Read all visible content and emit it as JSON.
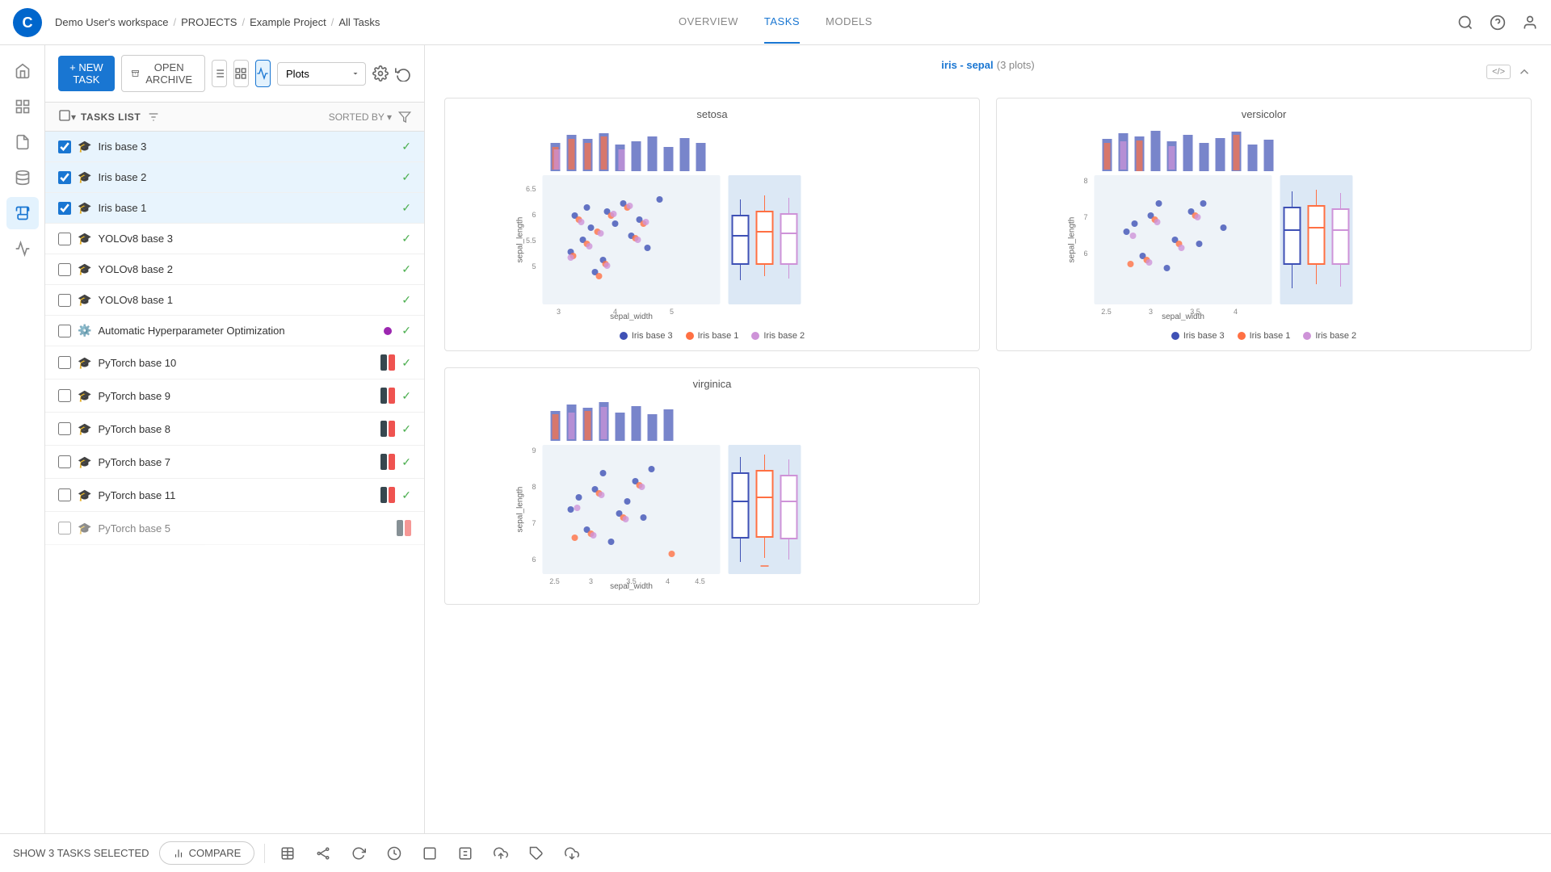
{
  "app": {
    "logo_text": "C",
    "breadcrumb": [
      "Demo User's workspace",
      "PROJECTS",
      "Example Project",
      "All Tasks"
    ]
  },
  "nav": {
    "tabs": [
      "OVERVIEW",
      "TASKS",
      "MODELS"
    ],
    "active_tab": "TASKS"
  },
  "toolbar": {
    "new_task_label": "+ NEW TASK",
    "open_archive_label": "OPEN ARCHIVE",
    "plots_label": "Plots"
  },
  "tasks_list": {
    "header_label": "TASKS LIST",
    "sorted_by_label": "SORTED BY",
    "items": [
      {
        "name": "Iris base 3",
        "checked": true,
        "selected": true,
        "status": "check",
        "type": "model"
      },
      {
        "name": "Iris base 2",
        "checked": true,
        "selected": true,
        "status": "check",
        "type": "model"
      },
      {
        "name": "Iris base 1",
        "checked": true,
        "selected": true,
        "status": "check",
        "type": "model"
      },
      {
        "name": "YOLOv8 base 3",
        "checked": false,
        "selected": false,
        "status": "check",
        "type": "model"
      },
      {
        "name": "YOLOv8 base 2",
        "checked": false,
        "selected": false,
        "status": "check",
        "type": "model"
      },
      {
        "name": "YOLOv8 base 1",
        "checked": false,
        "selected": false,
        "status": "check",
        "type": "model"
      },
      {
        "name": "Automatic Hyperparameter Optimization",
        "checked": false,
        "selected": false,
        "status": "purple_check",
        "type": "hpo"
      },
      {
        "name": "PyTorch base 10",
        "checked": false,
        "selected": false,
        "status": "dual_check",
        "type": "model"
      },
      {
        "name": "PyTorch base 9",
        "checked": false,
        "selected": false,
        "status": "dual_check",
        "type": "model"
      },
      {
        "name": "PyTorch base 8",
        "checked": false,
        "selected": false,
        "status": "dual_check",
        "type": "model"
      },
      {
        "name": "PyTorch base 7",
        "checked": false,
        "selected": false,
        "status": "dual_check",
        "type": "model"
      },
      {
        "name": "PyTorch base 11",
        "checked": false,
        "selected": false,
        "status": "dual_check",
        "type": "model"
      }
    ]
  },
  "plots_section": {
    "title": "iris - sepal",
    "subtitle": "(3 plots)",
    "plots": [
      {
        "title": "setosa",
        "x_label": "sepal_width",
        "y_label": "sepal_length"
      },
      {
        "title": "versicolor",
        "x_label": "sepal_width",
        "y_label": "sepal_length"
      },
      {
        "title": "virginica",
        "x_label": "sepal_width",
        "y_label": "sepal_length"
      }
    ],
    "legend": [
      {
        "label": "Iris base 3",
        "color": "#3f51b5"
      },
      {
        "label": "Iris base 1",
        "color": "#ff7043"
      },
      {
        "label": "Iris base 2",
        "color": "#ce93d8"
      }
    ]
  },
  "bottom_bar": {
    "show_selected_label": "SHOW 3 TASKS SELECTED",
    "compare_label": "COMPARE"
  }
}
